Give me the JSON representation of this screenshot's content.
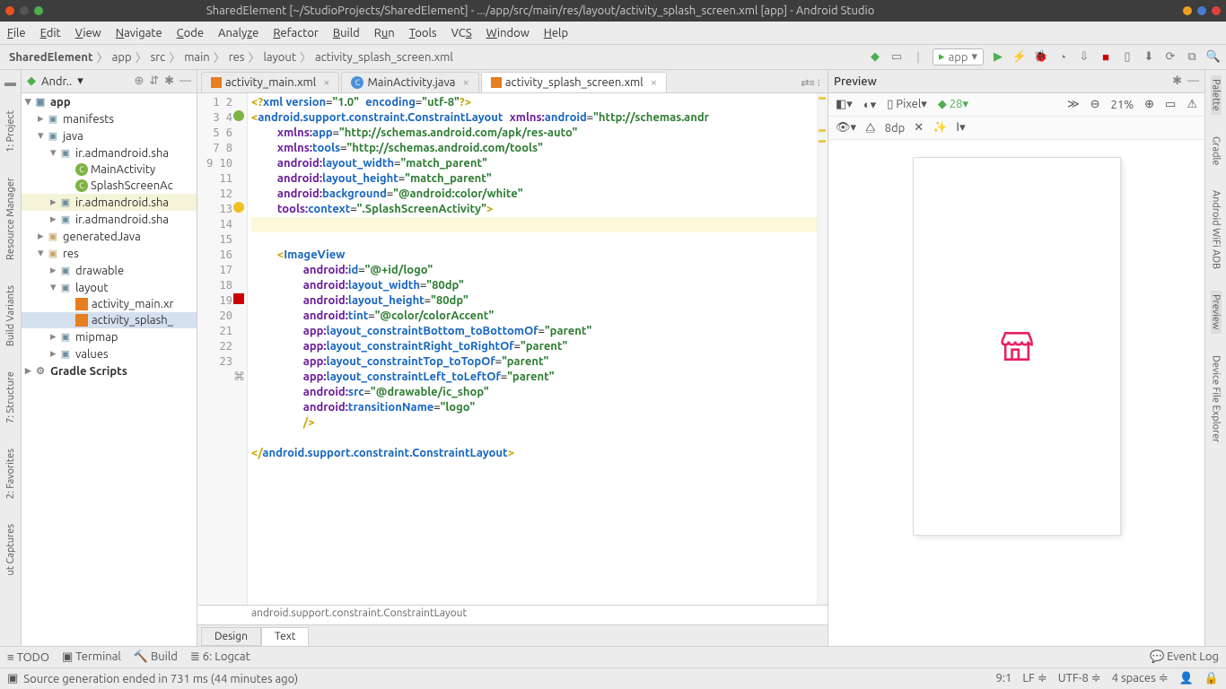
{
  "title": "SharedElement [~/StudioProjects/SharedElement] - .../app/src/main/res/layout/activity_splash_screen.xml [app] - Android Studio",
  "menu": [
    "File",
    "Edit",
    "View",
    "Navigate",
    "Code",
    "Analyze",
    "Refactor",
    "Build",
    "Run",
    "Tools",
    "VCS",
    "Window",
    "Help"
  ],
  "breadcrumbs": [
    "SharedElement",
    "app",
    "src",
    "main",
    "res",
    "layout",
    "activity_splash_screen.xml"
  ],
  "run_config": "app",
  "left_tools": [
    "1: Project",
    "Resource Manager",
    "Build Variants",
    "7: Structure",
    "2: Favorites",
    "ut Captures"
  ],
  "right_tools": [
    "Gradle",
    "Android WiFi ADB",
    "Preview",
    "Device File Explorer"
  ],
  "project_header": "Andr..",
  "tree": {
    "app": "app",
    "manifests": "manifests",
    "java": "java",
    "pkg1": "ir.admandroid.sha",
    "main_activity": "MainActivity",
    "splash_act": "SplashScreenAc",
    "pkg2": "ir.admandroid.sha",
    "pkg3": "ir.admandroid.sha",
    "genjava": "generatedJava",
    "res": "res",
    "drawable": "drawable",
    "layout": "layout",
    "act_main": "activity_main.xr",
    "act_splash": "activity_splash_",
    "mipmap": "mipmap",
    "values": "values",
    "gradle": "Gradle Scripts"
  },
  "tabs": {
    "t1": "activity_main.xml",
    "t2": "MainActivity.java",
    "t3": "activity_splash_screen.xml"
  },
  "code_lines": 23,
  "crumb_element": "android.support.constraint.ConstraintLayout",
  "bottom_tabs": {
    "design": "Design",
    "text": "Text"
  },
  "preview": {
    "title": "Preview",
    "device": "Pixel",
    "api": "28",
    "zoom": "21%",
    "dp": "8dp"
  },
  "status": {
    "todo": "TODO",
    "terminal": "Terminal",
    "build": "Build",
    "logcat": "6: Logcat",
    "eventlog": "Event Log",
    "msg": "Source generation ended in 731 ms (44 minutes ago)",
    "pos": "9:1",
    "lf": "LF",
    "enc": "UTF-8",
    "indent": "4 spaces"
  },
  "xml": {
    "decl_version": "\"1.0\"",
    "decl_enc": "\"utf-8\"",
    "root_tag": "android.support.constraint.ConstraintLayout",
    "xmlns_android": "\"http://schemas.andr",
    "xmlns_app": "\"http://schemas.android.com/apk/res-auto\"",
    "xmlns_tools": "\"http://schemas.android.com/tools\"",
    "lw": "\"match_parent\"",
    "lh": "\"match_parent\"",
    "bg": "\"@android:color/white\"",
    "ctx": "\".SplashScreenActivity\"",
    "iv": "ImageView",
    "id": "\"@+id/logo\"",
    "iw": "\"80dp\"",
    "ih": "\"80dp\"",
    "tint": "\"@color/colorAccent\"",
    "cb": "\"parent\"",
    "cr": "\"parent\"",
    "ct": "\"parent\"",
    "cl": "\"parent\"",
    "src": "\"@drawable/ic_shop\"",
    "tn": "\"logo\""
  }
}
